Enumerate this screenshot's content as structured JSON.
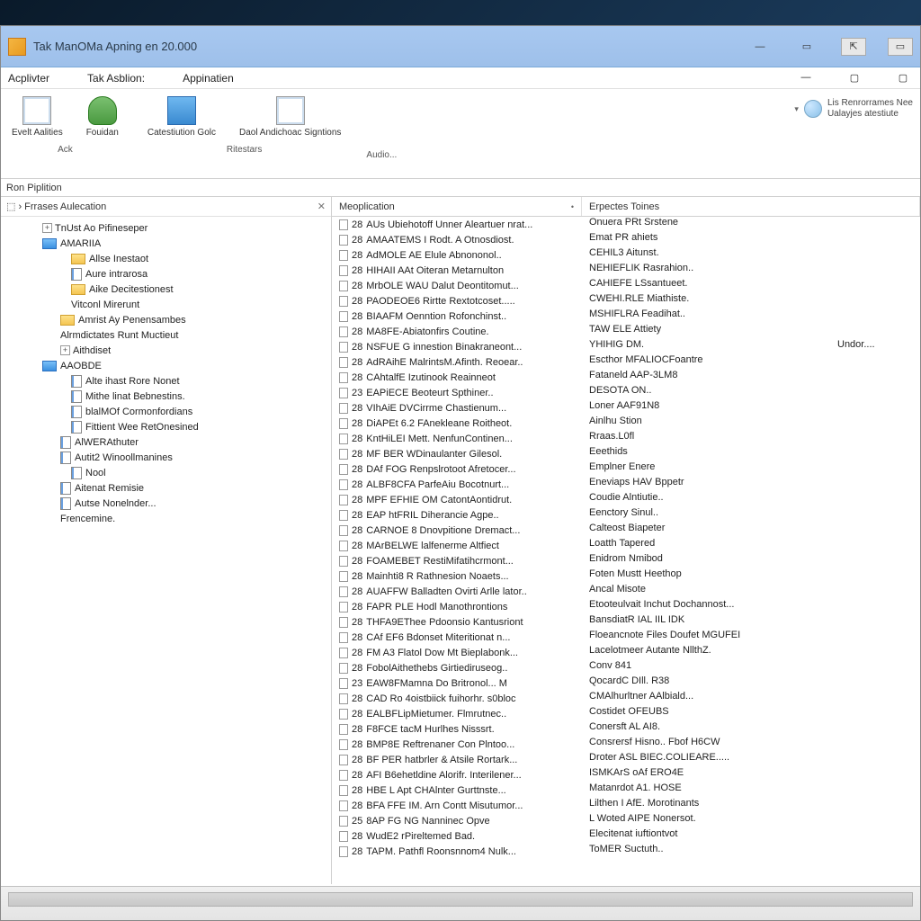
{
  "title": "Tak ManOMa Apning en 20.000",
  "menu": [
    "Acplivter",
    "Tak Asblion:",
    "Appinatien"
  ],
  "ribbon": {
    "btn1": "Evelt Aalities",
    "btn2": "Fouidan",
    "btn3": "Catestiution Golc",
    "btn4": "Daol Andichoac Signtions",
    "group_left": "Ack",
    "group_mid": "Ritestars",
    "group_right": "Audio...",
    "right_line1": "Lis Renrorrames Nee",
    "right_line2": "Ualayjes atestiute"
  },
  "breadcrumb": "Ron Piplition",
  "tree_header": "Frrases Aulecation",
  "tree": [
    {
      "ind": 44,
      "ico": "exp",
      "label": "TnUst Ao Pifineseper"
    },
    {
      "ind": 44,
      "ico": "folderblue",
      "label": "AMARIIA"
    },
    {
      "ind": 76,
      "ico": "folder",
      "label": "Allse Inestaot"
    },
    {
      "ind": 76,
      "ico": "doc",
      "label": "Aure intrarosa"
    },
    {
      "ind": 76,
      "ico": "folder",
      "label": "Aike Decitestionest"
    },
    {
      "ind": 76,
      "ico": "none",
      "label": "Vitconl Mirerunt"
    },
    {
      "ind": 64,
      "ico": "folder",
      "label": "Amrist Ay Penensambes"
    },
    {
      "ind": 64,
      "ico": "none",
      "label": "Alrmdictates Runt Muctieut"
    },
    {
      "ind": 64,
      "ico": "exp",
      "label": "Aithdiset"
    },
    {
      "ind": 44,
      "ico": "folderblue",
      "label": "AAOBDE"
    },
    {
      "ind": 76,
      "ico": "doc",
      "label": "Alte ihast Rore Nonet"
    },
    {
      "ind": 76,
      "ico": "doc",
      "label": "Mithe linat Bebnestins."
    },
    {
      "ind": 76,
      "ico": "doc",
      "label": "blalMOf Cormonfordians"
    },
    {
      "ind": 76,
      "ico": "doc",
      "label": "Fittient Wee RetOnesined"
    },
    {
      "ind": 64,
      "ico": "doc",
      "label": "AlWERAthuter"
    },
    {
      "ind": 64,
      "ico": "doc",
      "label": "Autit2 Winoollmanines"
    },
    {
      "ind": 76,
      "ico": "doc",
      "label": "Nool"
    },
    {
      "ind": 64,
      "ico": "doc",
      "label": "Aitenat Remisie"
    },
    {
      "ind": 64,
      "ico": "doc",
      "label": "Autse Nonelnder..."
    },
    {
      "ind": 64,
      "ico": "none",
      "label": "Frencemine."
    }
  ],
  "columns": {
    "c1": "Meoplication",
    "c2": "Erpectes  Toines"
  },
  "rows": [
    {
      "a": "28",
      "b": "AUs Ubiehotoff Unner Aleartuer nrat...",
      "c": "Onuera PRt Srstene"
    },
    {
      "a": "28",
      "b": "AMAATEMS I Rodt. A Otnosdiost.",
      "c": "Emat PR ahiets"
    },
    {
      "a": "28",
      "b": "AdMOLE AE Elule Abnononol..",
      "c": "CEHIL3 Aitunst."
    },
    {
      "a": "28",
      "b": "HIHAII AAt Oiteran Metarnulton",
      "c": "NEHIEFLIK Rasrahion.."
    },
    {
      "a": "28",
      "b": "MrbOLE WAU Dalut Deontitomut...",
      "c": "CAHIEFE LSsantueet."
    },
    {
      "a": "28",
      "b": "PAODEOE6 Rirtte Rextotcoset.....",
      "c": "CWEHI.RLE Miathiste."
    },
    {
      "a": "28",
      "b": "BIAAFM Oenntion Rofonchinst..",
      "c": "MSHIFLRA Feadihat.."
    },
    {
      "a": "28",
      "b": "MA8FE-Abiatonfirs Coutine.",
      "c": "TAW ELE Attiety"
    },
    {
      "a": "28",
      "b": "NSFUE G innestion Binakraneont...",
      "c": "YHIHIG DM."
    },
    {
      "a": "28",
      "b": "AdRAihE MalrintsM.Afinth. Reoear..",
      "c": "Escthor MFALIOCFoantre"
    },
    {
      "a": "28",
      "b": "CAhtalfE Izutinook Reainneot",
      "c": "Fataneld AAP-3LM8"
    },
    {
      "a": "23",
      "b": "EAPiECE Beoteurt Spthiner..",
      "c": "DESOTA ON.."
    },
    {
      "a": "28",
      "b": "VIhAiE DVCirrme Chastienum...",
      "c": "Loner AAF91N8"
    },
    {
      "a": "28",
      "b": "DiAPEt 6.2 FAnekleane Roitheot.",
      "c": "Ainlhu Stion"
    },
    {
      "a": "28",
      "b": "KntHiLEI Mett. NenfunContinen...",
      "c": "Rraas.L0fl"
    },
    {
      "a": "28",
      "b": "MF BER WDinaulanter Gilesol.",
      "c": "Eeethids"
    },
    {
      "a": "28",
      "b": "DAf FOG Renpslrotoot Afretocer...",
      "c": "Emplner Enere"
    },
    {
      "a": "28",
      "b": "ALBF8CFA ParfeAiu Bocotnurt...",
      "c": "Eneviaps HAV Bppetr"
    },
    {
      "a": "28",
      "b": "MPF EFHIE OM CatontAontidrut.",
      "c": "Coudie Alntiutie.."
    },
    {
      "a": "28",
      "b": "EAP htFRIL Diherancie Agpe..",
      "c": "Eenctory Sinul.."
    },
    {
      "a": "28",
      "b": "CARNOE 8 Dnovpitione Dremact...",
      "c": "Calteost Biapeter"
    },
    {
      "a": "28",
      "b": "MArBELWE lalfenerme Altfiect",
      "c": "Loatth Tapered"
    },
    {
      "a": "28",
      "b": "FOAMEBET RestiMifatihcrmont...",
      "c": "Enidrom Nmibod"
    },
    {
      "a": "28",
      "b": "Mainhti8 R Rathnesion Noaets...",
      "c": "Foten Mustt Heethop"
    },
    {
      "a": "28",
      "b": "AUAFFW Balladten Ovirti Arlle lator..",
      "c": "Ancal Misote"
    },
    {
      "a": "28",
      "b": "FAPR PLE Hodl Manothrontions",
      "c": "Etooteulvait Inchut Dochannost..."
    },
    {
      "a": "28",
      "b": "THFA9EThee Pdoonsio Kantusriont",
      "c": "BansdiatR IAL IIL IDK"
    },
    {
      "a": "28",
      "b": "CAf EF6 Bdonset Miteritionat n...",
      "c": "Floeancnote Files Doufet MGUFEI"
    },
    {
      "a": "28",
      "b": "FM A3 Flatol Dow Mt Bieplabonk...",
      "c": "Lacelotmeer Autante NllthZ."
    },
    {
      "a": "28",
      "b": "FobolAithethebs Girtiediruseog..",
      "c": "Conv 841"
    },
    {
      "a": "23",
      "b": "EAW8FMamna Do Britronol... M",
      "c": "QocardC DIll. R38"
    },
    {
      "a": "28",
      "b": "CAD Ro 4oistbiick fuihorhr. s0bloc",
      "c": "CMAlhurltner AAlbiald..."
    },
    {
      "a": "28",
      "b": "EALBFLipMietumer. Flmrutnec..",
      "c": "Costidet OFEUBS"
    },
    {
      "a": "28",
      "b": "F8FCE tacM Hurlhes Nisssrt.",
      "c": "Conersft AL AI8."
    },
    {
      "a": "28",
      "b": "BMP8E Reftrenaner Con Plntoo...",
      "c": "Consrersf Hisno.. Fbof H6CW"
    },
    {
      "a": "28",
      "b": "BF PER hatbrler & Atsile Rortark...",
      "c": "Droter ASL BIEC.COLIEARE....."
    },
    {
      "a": "28",
      "b": "AFI B6ehetldine Alorifr. Interilener...",
      "c": "ISMKArS oAf ERO4E"
    },
    {
      "a": "28",
      "b": "HBE L Apt CHAlnter Gurttnste...",
      "c": "Matanrdot A1. HOSE"
    },
    {
      "a": "28",
      "b": "BFA FFE IM. Arn Contt Misutumor...",
      "c": "Lilthen I AfE. Morotinants"
    },
    {
      "a": "25",
      "b": "8AP FG NG Nanninec Opve",
      "c": "L Woted AIPE Nonersot."
    },
    {
      "a": "28",
      "b": "WudE2 rPireltemed Bad.",
      "c": "Elecitenat iuftiontvot"
    },
    {
      "a": "28",
      "b": "TAPM. Pathfl Roonsnnom4 Nulk...",
      "c": "ToMER Suctuth.."
    }
  ],
  "extra_col": "Undor...."
}
